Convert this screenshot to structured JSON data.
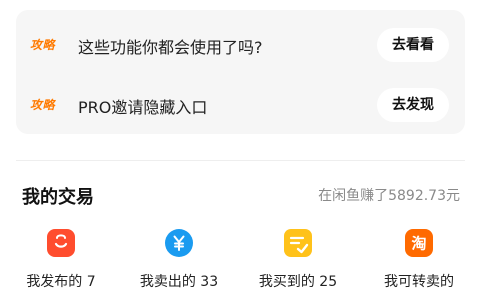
{
  "guides": [
    {
      "tag": "攻略",
      "text": "这些功能你都会使用了吗?",
      "button": "去看看"
    },
    {
      "tag": "攻略",
      "text": "PRO邀请隐藏入口",
      "button": "去发现"
    }
  ],
  "trades": {
    "title": "我的交易",
    "earnings": "在闲鱼赚了5892.73元",
    "items": [
      {
        "label": "我发布的 7",
        "icon": "shopping-bag-icon",
        "color": "#ff4d2e"
      },
      {
        "label": "我卖出的 33",
        "icon": "yuan-coin-icon",
        "color": "#1a9bf0"
      },
      {
        "label": "我买到的 25",
        "icon": "order-check-icon",
        "color": "#ffc21a"
      },
      {
        "label": "我可转卖的",
        "icon": "taobao-icon",
        "color": "#ff6a00"
      }
    ]
  }
}
